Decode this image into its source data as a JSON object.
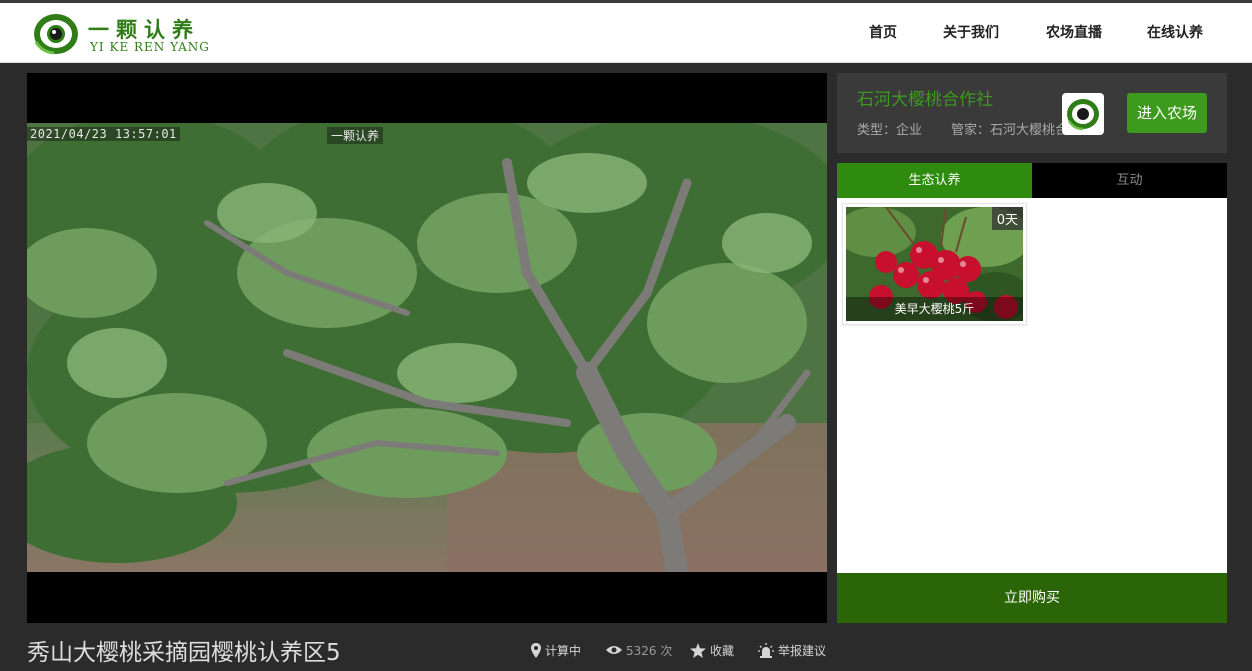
{
  "header": {
    "logo_cn": "一颗认养",
    "logo_en": "YI KE REN YANG",
    "nav": [
      "首页",
      "关于我们",
      "农场直播",
      "在线认养"
    ]
  },
  "video": {
    "osd_time": "2021/04/23 13:57:01",
    "osd_brand": "一颗认养"
  },
  "farm": {
    "name": "石河大樱桃合作社",
    "type_label": "类型：企业",
    "manager_label": "管家：石河大樱桃合作社",
    "enter_button": "进入农场"
  },
  "tabs": [
    "生态认养",
    "互动"
  ],
  "products": [
    {
      "days": "0天",
      "name": "美早大樱桃5斤"
    }
  ],
  "buy_button": "立即购买",
  "footer": {
    "title": "秀山大樱桃采摘园樱桃认养区5",
    "location": "计算中",
    "views": "5326 次",
    "favorite": "收藏",
    "report": "举报建议"
  },
  "colors": {
    "brand_green": "#2f7d17",
    "accent_green": "#3c9a1c",
    "tab_active": "#2e8b0e",
    "buy_button": "#2a6608",
    "page_bg": "#2b2b2b"
  },
  "icons": [
    "logo-icon",
    "location-pin-icon",
    "eye-icon",
    "star-icon",
    "alarm-icon"
  ]
}
